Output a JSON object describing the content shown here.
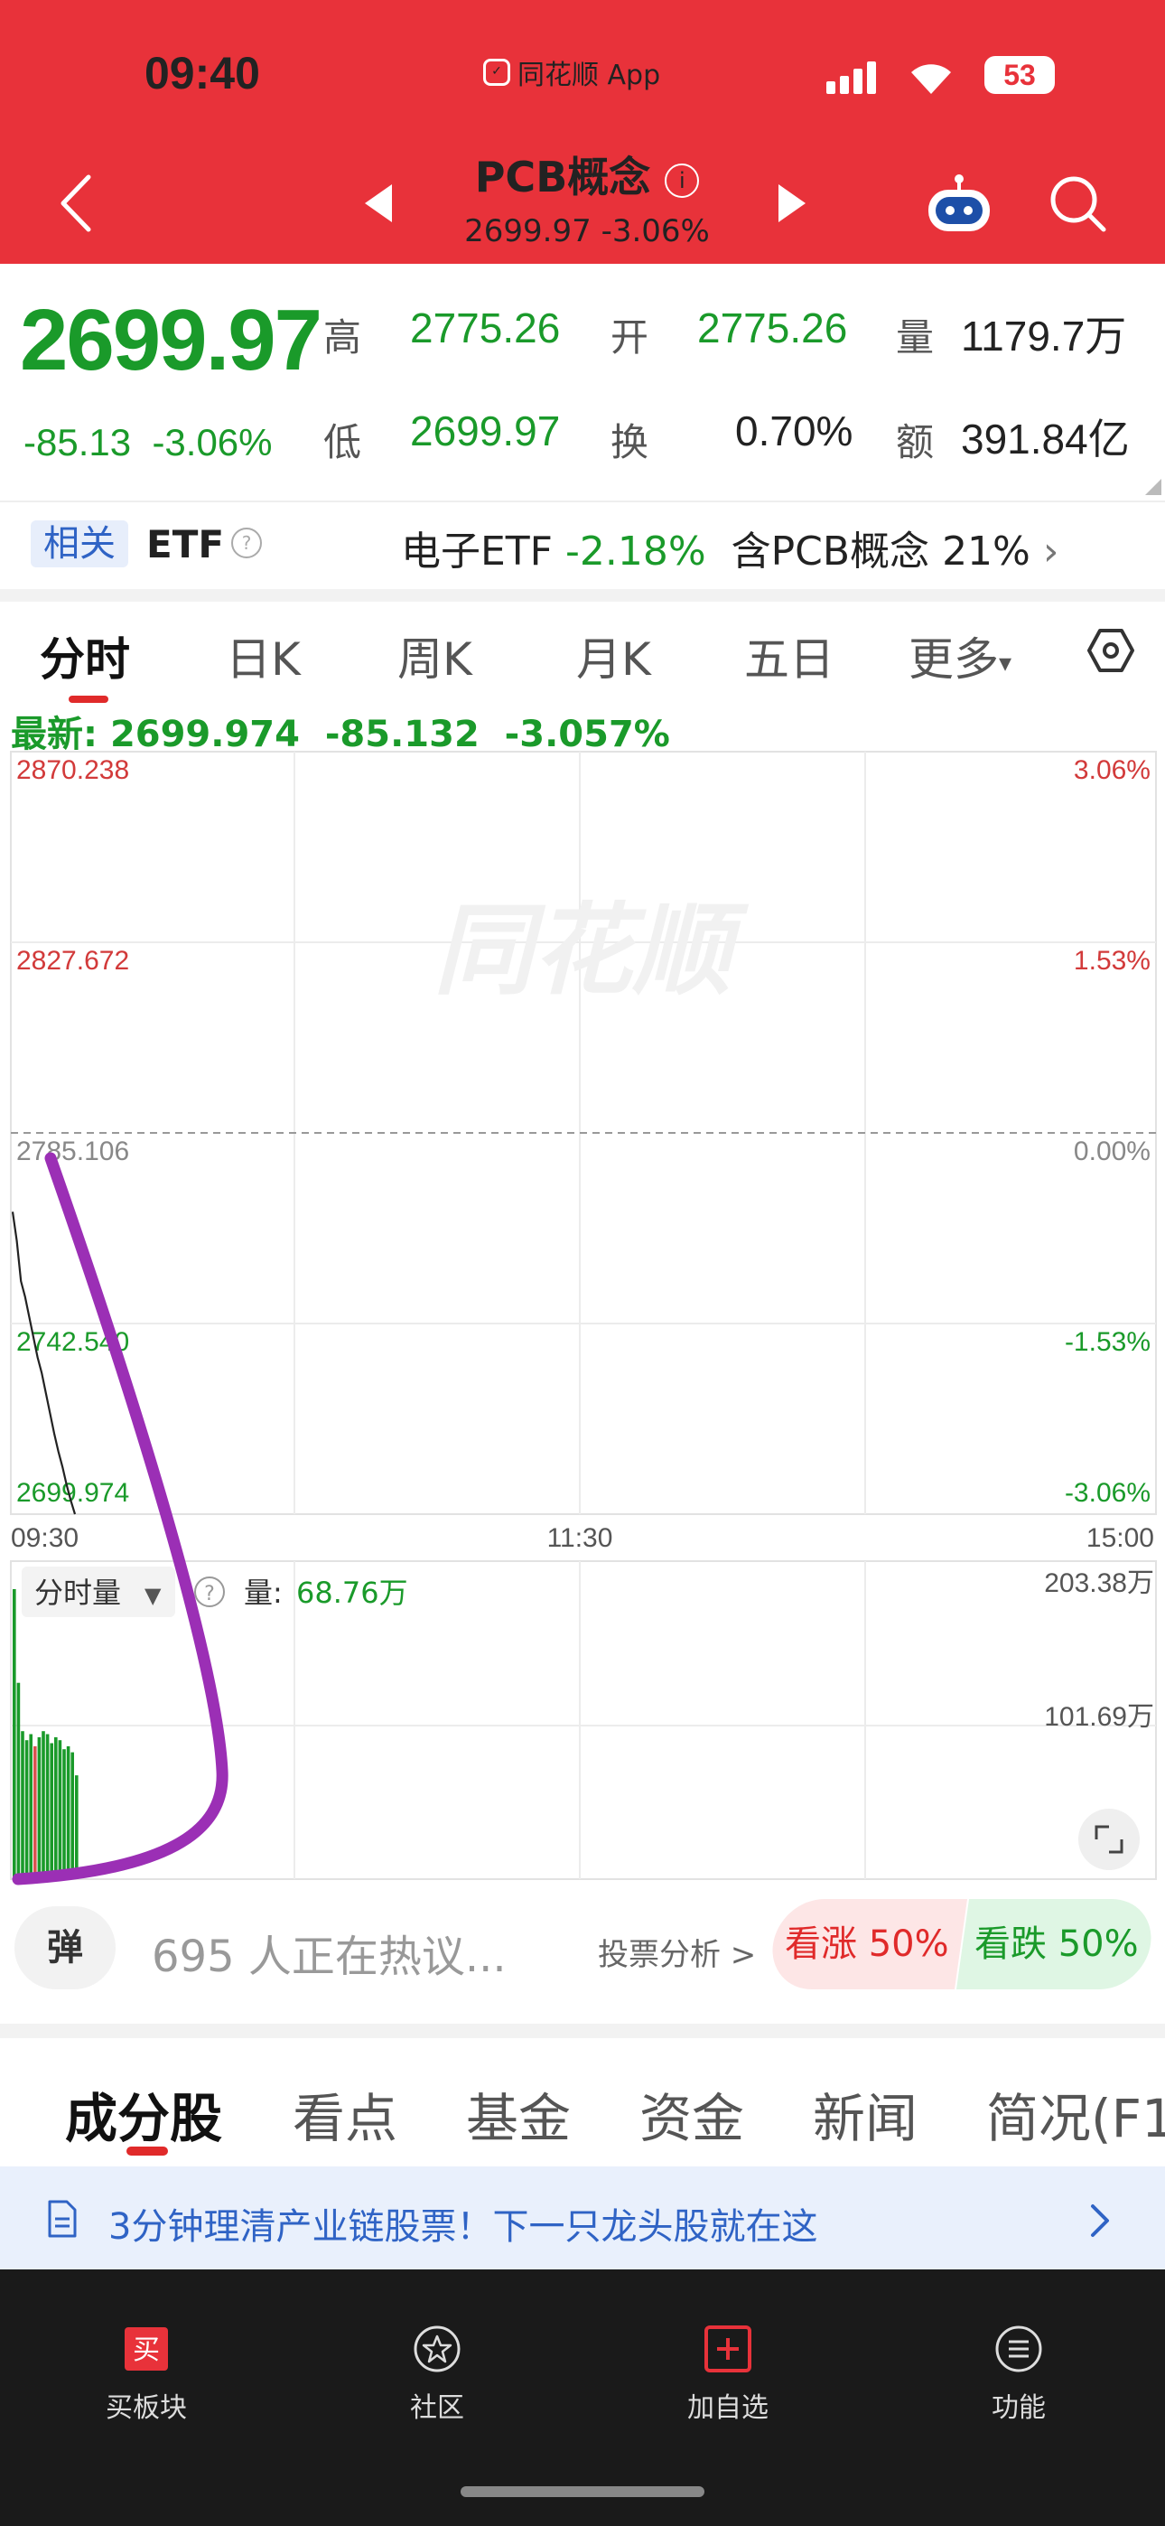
{
  "status_bar": {
    "time": "09:40",
    "app_name": "同花顺 App",
    "battery": "53"
  },
  "header": {
    "title": "PCB概念",
    "title_info_icon": "info-icon",
    "price_line": "2699.97 -3.06%",
    "background_color": "#e8323a"
  },
  "quote": {
    "price": "2699.97",
    "change": "-85.13",
    "change_pct": "-3.06%",
    "high_label": "高",
    "high": "2775.26",
    "low_label": "低",
    "low": "2699.97",
    "open_label": "开",
    "open": "2775.26",
    "turnover_label": "换",
    "turnover": "0.70%",
    "volume_label": "量",
    "volume": "1179.7万",
    "amount_label": "额",
    "amount": "391.84亿"
  },
  "etf": {
    "tag": "相关",
    "label": "ETF",
    "info": "电子ETF",
    "info_change": "-2.18%",
    "info_holding": "含PCB概念 21%"
  },
  "chart_tabs": [
    "分时",
    "日K",
    "周K",
    "月K",
    "五日",
    "更多"
  ],
  "latest": {
    "label": "最新:",
    "value": "2699.974",
    "change": "-85.132",
    "change_pct": "-3.057%"
  },
  "chart_data": {
    "type": "line",
    "watermark": "同花顺",
    "price_axis": [
      "2870.238",
      "2827.672",
      "2785.106",
      "2742.540",
      "2699.974"
    ],
    "pct_axis": [
      "3.06%",
      "1.53%",
      "0.00%",
      "-1.53%",
      "-3.06%"
    ],
    "x_ticks": [
      "09:30",
      "11:30",
      "15:00"
    ],
    "ylim": [
      2699.974,
      2870.238
    ],
    "prev_close": 2785.106,
    "series": [
      {
        "values": [
          2767.5,
          2761.0,
          2752.0,
          2748.5,
          2744.0,
          2739.5,
          2735.0,
          2731.5,
          2727.0,
          2722.5,
          2718.0,
          2714.0,
          2710.5,
          2706.5,
          2703.0,
          2699.974
        ]
      }
    ],
    "volume": {
      "selector_label": "分时量",
      "label": "量:",
      "value": "68.76万",
      "axis": [
        "203.38万",
        "101.69万"
      ],
      "ylim": [
        0,
        203.38
      ],
      "bars": [
        192,
        130,
        98,
        92,
        96,
        88,
        94,
        98,
        96,
        90,
        94,
        92,
        86,
        88,
        84,
        68.76
      ],
      "bar_colors": [
        "green",
        "green",
        "green",
        "green",
        "green",
        "red",
        "green",
        "green",
        "green",
        "green",
        "green",
        "green",
        "green",
        "green",
        "green",
        "green"
      ]
    }
  },
  "discussion": {
    "danmu_button": "弹",
    "hot_text": "695 人正在热议...",
    "vote_link": "投票分析 >",
    "bull": "看涨 50%",
    "bear": "看跌 50%"
  },
  "section_tabs": [
    "成分股",
    "看点",
    "基金",
    "资金",
    "新闻",
    "简况(F1"
  ],
  "banner": {
    "text": "3分钟理清产业链股票！下一只龙头股就在这"
  },
  "bottom_nav": [
    {
      "label": "买板块",
      "icon": "buy-icon"
    },
    {
      "label": "社区",
      "icon": "community-icon"
    },
    {
      "label": "加自选",
      "icon": "add-favorite-icon"
    },
    {
      "label": "功能",
      "icon": "menu-icon"
    }
  ],
  "colors": {
    "accent_red": "#e02a2a",
    "accent_green": "#1a9a2a",
    "link_blue": "#2f63c5",
    "annotation_purple": "#9b2fb5"
  }
}
